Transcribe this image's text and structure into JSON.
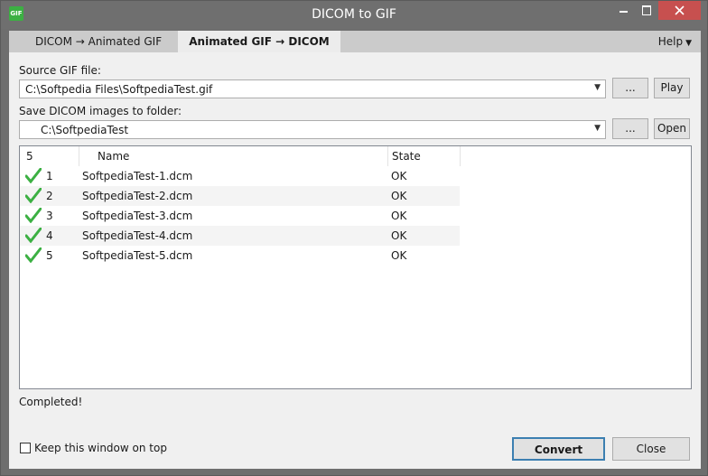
{
  "window": {
    "title": "DICOM to GIF",
    "icon_text": "GIF",
    "icons": [
      "minimize-icon",
      "maximize-icon",
      "close-icon"
    ]
  },
  "tabs": {
    "items": [
      {
        "label": "DICOM  →  Animated GIF",
        "active": false
      },
      {
        "label": "Animated GIF  →  DICOM",
        "active": true
      }
    ],
    "help_label": "Help"
  },
  "source": {
    "label": "Source GIF file:",
    "value": "C:\\Softpedia Files\\SoftpediaTest.gif",
    "browse_label": "...",
    "play_label": "Play"
  },
  "dest": {
    "label": "Save DICOM images to folder:",
    "value": "C:\\SoftpediaTest",
    "browse_label": "...",
    "open_label": "Open"
  },
  "list": {
    "columns": [
      "5",
      "Name",
      "State"
    ],
    "rows": [
      {
        "num": "1",
        "name": "SoftpediaTest-1.dcm",
        "state": "OK"
      },
      {
        "num": "2",
        "name": "SoftpediaTest-2.dcm",
        "state": "OK"
      },
      {
        "num": "3",
        "name": "SoftpediaTest-3.dcm",
        "state": "OK"
      },
      {
        "num": "4",
        "name": "SoftpediaTest-4.dcm",
        "state": "OK"
      },
      {
        "num": "5",
        "name": "SoftpediaTest-5.dcm",
        "state": "OK"
      }
    ],
    "row_icon": "check-icon"
  },
  "status_text": "Completed!",
  "footer": {
    "keep_on_top_label": "Keep this window on top",
    "keep_on_top_checked": false,
    "convert_label": "Convert",
    "close_label": "Close"
  },
  "colors": {
    "titlebar": "#6f6f6f",
    "close_button": "#c7504f",
    "check": "#3cb043",
    "accent_border": "#3c7fb1"
  }
}
